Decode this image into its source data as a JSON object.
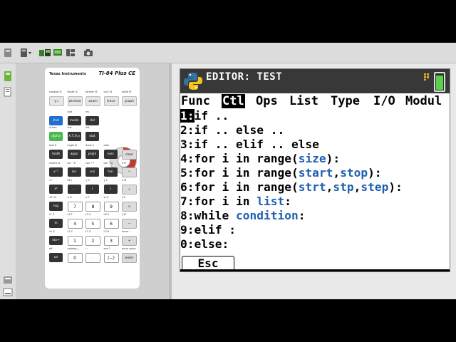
{
  "toolbar": {
    "icons": [
      "keypad-icon",
      "calculator-settings-icon",
      "file-transfer-icon",
      "display-icon",
      "screenshot-camera-icon"
    ]
  },
  "calculator": {
    "brand": "Texas Instruments",
    "model": "TI-84 Plus CE",
    "keys": [
      {
        "row": 0,
        "labels": [
          "y=",
          "window",
          "zoom",
          "trace",
          "graph"
        ],
        "tops": [
          "statplot f1",
          "tblset f2",
          "format f3",
          "calc f4",
          "table f5"
        ]
      },
      {
        "row": 1,
        "labels": [
          "2nd",
          "mode",
          "del"
        ],
        "tops": [
          "",
          "quit",
          "ins"
        ]
      },
      {
        "row": 2,
        "labels": [
          "alpha",
          "X,T,θ,n",
          "stat"
        ],
        "tops": [
          "A-lock",
          "link",
          "list"
        ]
      },
      {
        "row": 3,
        "labels": [
          "math",
          "apps",
          "prgm",
          "vars",
          "clear"
        ],
        "tops": [
          "test A",
          "angle B",
          "draw C",
          "distr",
          ""
        ]
      },
      {
        "row": 4,
        "labels": [
          "x⁻¹",
          "sin",
          "cos",
          "tan",
          "^"
        ],
        "tops": [
          "matrix D",
          "sin⁻¹ E",
          "cos⁻¹ F",
          "tan⁻¹ G",
          "π H"
        ]
      },
      {
        "row": 5,
        "labels": [
          "x²",
          ",",
          "(",
          ")",
          "÷"
        ],
        "tops": [
          "√ I",
          "EE J",
          "{ K",
          "} L",
          "e M"
        ]
      },
      {
        "row": 6,
        "labels": [
          "log",
          "7",
          "8",
          "9",
          "×"
        ],
        "tops": [
          "10ˣ N",
          "u O",
          "v P",
          "w Q",
          "[ R"
        ]
      },
      {
        "row": 7,
        "labels": [
          "ln",
          "4",
          "5",
          "6",
          "−"
        ],
        "tops": [
          "eˣ S",
          "L4 T",
          "L5 U",
          "L6 V",
          "] W"
        ]
      },
      {
        "row": 8,
        "labels": [
          "sto→",
          "1",
          "2",
          "3",
          "+"
        ],
        "tops": [
          "rcl X",
          "L1 Y",
          "L2 Z",
          "L3 θ",
          "mem \""
        ]
      },
      {
        "row": 9,
        "labels": [
          "on",
          "0",
          ".",
          "(−)",
          "enter"
        ],
        "tops": [
          "off",
          "catalog ␣",
          "i :",
          "ans ?",
          "entry solve"
        ]
      }
    ]
  },
  "editor": {
    "title": "EDITOR: TEST",
    "menu": [
      "Func",
      "Ctl",
      "Ops",
      "List",
      "Type",
      "I/O",
      "Modul"
    ],
    "active_menu": "Ctl",
    "lines": [
      {
        "num": "1:",
        "parts": [
          {
            "t": "if ..",
            "k": false
          }
        ]
      },
      {
        "num": "2:",
        "parts": [
          {
            "t": "if .. else ..",
            "k": false
          }
        ]
      },
      {
        "num": "3:",
        "parts": [
          {
            "t": "if .. elif .. else",
            "k": false
          }
        ]
      },
      {
        "num": "4:",
        "parts": [
          {
            "t": "for i in range(",
            "k": false
          },
          {
            "t": "size",
            "k": true
          },
          {
            "t": "):",
            "k": false
          }
        ]
      },
      {
        "num": "5:",
        "parts": [
          {
            "t": "for i in range(",
            "k": false
          },
          {
            "t": "start",
            "k": true
          },
          {
            "t": ",",
            "k": false
          },
          {
            "t": "stop",
            "k": true
          },
          {
            "t": "):",
            "k": false
          }
        ]
      },
      {
        "num": "6:",
        "parts": [
          {
            "t": "for i in range(",
            "k": false
          },
          {
            "t": "strt",
            "k": true
          },
          {
            "t": ",",
            "k": false
          },
          {
            "t": "stp",
            "k": true
          },
          {
            "t": ",",
            "k": false
          },
          {
            "t": "step",
            "k": true
          },
          {
            "t": "):",
            "k": false
          }
        ]
      },
      {
        "num": "7:",
        "parts": [
          {
            "t": "for i in ",
            "k": false
          },
          {
            "t": "list",
            "k": true
          },
          {
            "t": ":",
            "k": false
          }
        ]
      },
      {
        "num": "8:",
        "parts": [
          {
            "t": "while ",
            "k": false
          },
          {
            "t": "condition",
            "k": true
          },
          {
            "t": ":",
            "k": false
          }
        ]
      },
      {
        "num": "9:",
        "parts": [
          {
            "t": "elif :",
            "k": false
          }
        ]
      },
      {
        "num": "0:",
        "parts": [
          {
            "t": "else:",
            "k": false
          }
        ]
      }
    ],
    "selected_line": 0,
    "softkey": "Esc"
  },
  "colors": {
    "keyword_blue": "#2060b0",
    "titlebar_bg": "#383838",
    "battery_green": "#5bd04c"
  }
}
